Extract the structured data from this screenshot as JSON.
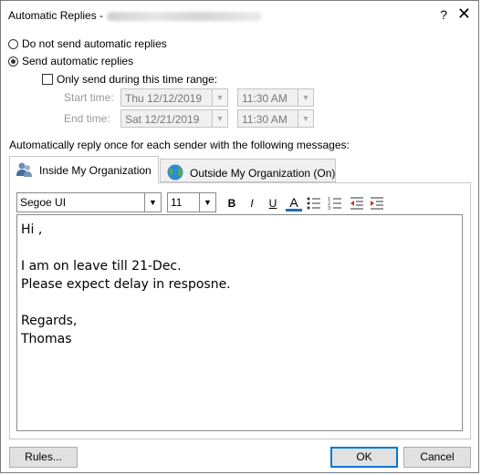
{
  "window": {
    "title": "Automatic Replies -",
    "help": "?",
    "close": "✕"
  },
  "options": {
    "no_reply": "Do not send automatic replies",
    "send_reply": "Send automatic replies",
    "time_range": "Only send during this time range:",
    "start_label": "Start time:",
    "start_date": "Thu 12/12/2019",
    "start_time": "11:30 AM",
    "end_label": "End time:",
    "end_date": "Sat 12/21/2019",
    "end_time": "11:30 AM"
  },
  "instructions": "Automatically reply once for each sender with the following messages:",
  "tabs": [
    {
      "label": "Inside My Organization",
      "icon": "people-icon",
      "active": true
    },
    {
      "label": "Outside My Organization (On)",
      "icon": "globe-icon",
      "active": false
    }
  ],
  "formatting": {
    "font": "Segoe UI",
    "size": "11",
    "bold": "B",
    "italic": "I",
    "underline": "U",
    "font_color": "A"
  },
  "message": {
    "line1": "Hi ,",
    "line2": "",
    "line3": "I am on leave till 21-Dec.",
    "line4": "Please expect delay in resposne.",
    "line5": "",
    "line6": "Regards,",
    "line7": "Thomas"
  },
  "buttons": {
    "rules": "Rules...",
    "ok": "OK",
    "cancel": "Cancel"
  },
  "colors": {
    "accent": "#0078d7",
    "underline_bar": "#1e6fb6",
    "indent_arrow": "#c0392b"
  }
}
